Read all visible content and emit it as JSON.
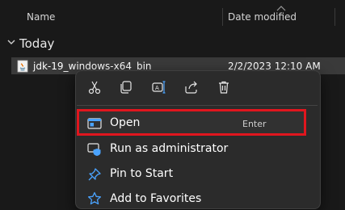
{
  "columns": {
    "name": "Name",
    "date_modified": "Date modified"
  },
  "group": {
    "label": "Today"
  },
  "file": {
    "name": "jdk-19_windows-x64_bin",
    "date": "2/2/2023 12:10 AM"
  },
  "context_menu": {
    "quick_actions": [
      "cut-icon",
      "copy-icon",
      "rename-icon",
      "share-icon",
      "delete-icon"
    ],
    "items": [
      {
        "label": "Open",
        "shortcut": "Enter",
        "icon": "open-app-icon"
      },
      {
        "label": "Run as administrator",
        "icon": "shield-icon"
      },
      {
        "label": "Pin to Start",
        "icon": "pin-icon"
      },
      {
        "label": "Add to Favorites",
        "icon": "star-icon"
      }
    ]
  },
  "colors": {
    "background": "#191919",
    "menu_background": "#2b2b2b",
    "highlight_border": "#e0161e",
    "accent_blue": "#4aa3ff"
  }
}
